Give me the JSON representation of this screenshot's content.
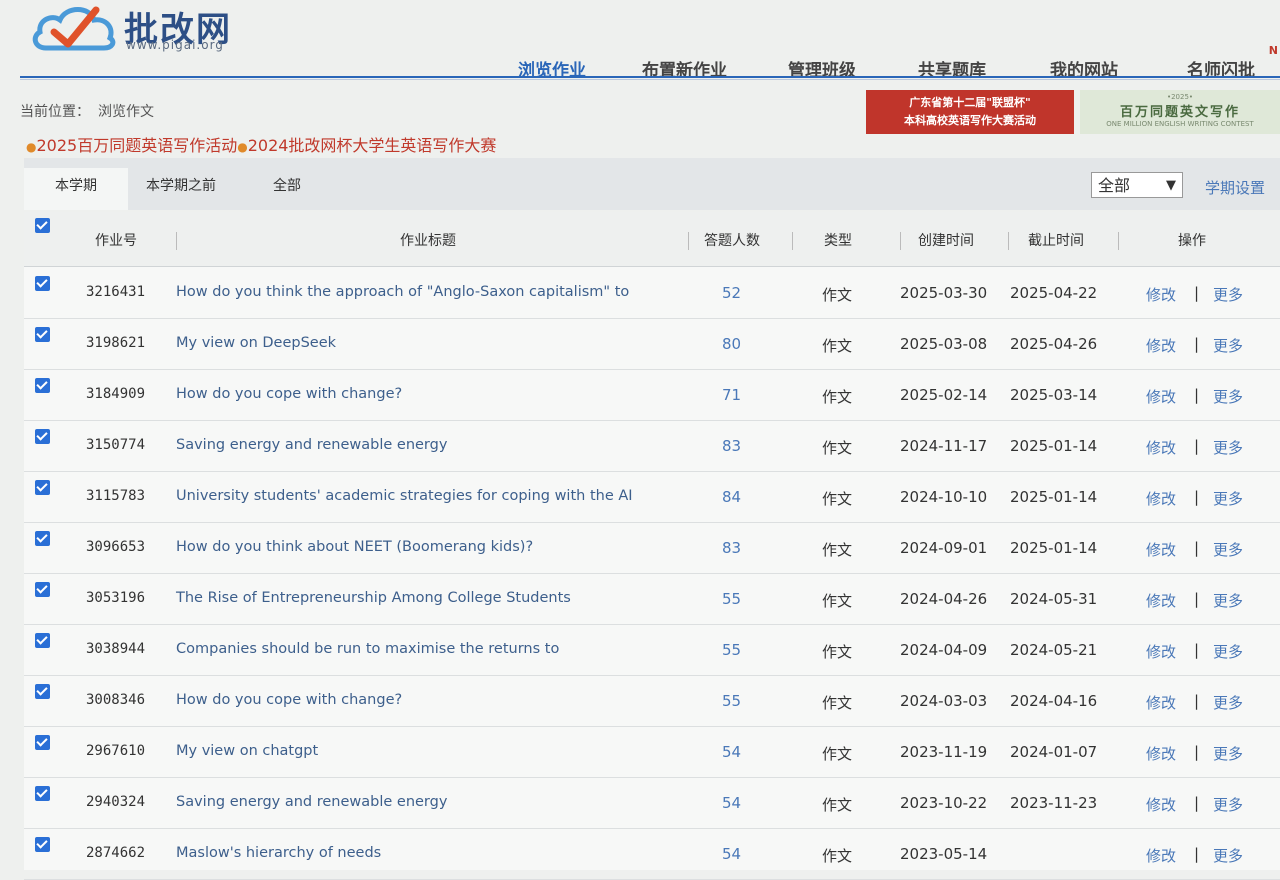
{
  "site": {
    "name": "批改网",
    "url": "www.pigai.org"
  },
  "nav": {
    "items": [
      "浏览作业",
      "布置新作业",
      "管理班级",
      "共享题库",
      "我的网站",
      "名师闪批"
    ],
    "active_index": 0,
    "new_badge": "N"
  },
  "breadcrumb": {
    "label": "当前位置：",
    "current": "浏览作文"
  },
  "contests": [
    "2025百万同题英语写作活动",
    "2024批改网杯大学生英语写作大赛"
  ],
  "banners": {
    "left_line1": "广东省第十二届\"联盟杯\"",
    "left_line2": "本科高校英语写作大赛活动",
    "right_year": "•2025•",
    "right_title": "百万同题英文写作",
    "right_sub": "ONE MILLION ENGLISH WRITING CONTEST"
  },
  "tabs": [
    "本学期",
    "本学期之前",
    "全部"
  ],
  "active_tab": 0,
  "term_filter": {
    "selected": "全部"
  },
  "term_setting_label": "学期设置",
  "table": {
    "headers": [
      "作业号",
      "作业标题",
      "答题人数",
      "类型",
      "创建时间",
      "截止时间",
      "操作"
    ],
    "action_edit": "修改",
    "action_sep": "|",
    "action_more": "更多",
    "rows": [
      {
        "id": "3216431",
        "title": "How do you think the approach of \"Anglo-Saxon capitalism\" to",
        "count": "52",
        "type": "作文",
        "created": "2025-03-30",
        "deadline": "2025-04-22"
      },
      {
        "id": "3198621",
        "title": "My view on DeepSeek",
        "count": "80",
        "type": "作文",
        "created": "2025-03-08",
        "deadline": "2025-04-26"
      },
      {
        "id": "3184909",
        "title": "How do you cope with change?",
        "count": "71",
        "type": "作文",
        "created": "2025-02-14",
        "deadline": "2025-03-14"
      },
      {
        "id": "3150774",
        "title": "Saving energy and renewable energy",
        "count": "83",
        "type": "作文",
        "created": "2024-11-17",
        "deadline": "2025-01-14"
      },
      {
        "id": "3115783",
        "title": "University students' academic strategies for coping with the AI",
        "count": "84",
        "type": "作文",
        "created": "2024-10-10",
        "deadline": "2025-01-14"
      },
      {
        "id": "3096653",
        "title": "How do you think about NEET (Boomerang kids)?",
        "count": "83",
        "type": "作文",
        "created": "2024-09-01",
        "deadline": "2025-01-14"
      },
      {
        "id": "3053196",
        "title": "The Rise of Entrepreneurship Among College Students",
        "count": "55",
        "type": "作文",
        "created": "2024-04-26",
        "deadline": "2024-05-31"
      },
      {
        "id": "3038944",
        "title": "Companies should be run to maximise the returns to",
        "count": "55",
        "type": "作文",
        "created": "2024-04-09",
        "deadline": "2024-05-21"
      },
      {
        "id": "3008346",
        "title": "How do you cope with change?",
        "count": "55",
        "type": "作文",
        "created": "2024-03-03",
        "deadline": "2024-04-16"
      },
      {
        "id": "2967610",
        "title": "My view on chatgpt",
        "count": "54",
        "type": "作文",
        "created": "2023-11-19",
        "deadline": "2024-01-07"
      },
      {
        "id": "2940324",
        "title": "Saving energy and renewable energy",
        "count": "54",
        "type": "作文",
        "created": "2023-10-22",
        "deadline": "2023-11-23"
      },
      {
        "id": "2874662",
        "title": "Maslow's hierarchy of needs",
        "count": "54",
        "type": "作文",
        "created": "2023-05-14",
        "deadline": ""
      }
    ]
  },
  "colors": {
    "accent": "#2a66b8",
    "checkbox": "#2a6fd6",
    "contest_red": "#c0392b",
    "link_blue": "#4a78b8"
  }
}
